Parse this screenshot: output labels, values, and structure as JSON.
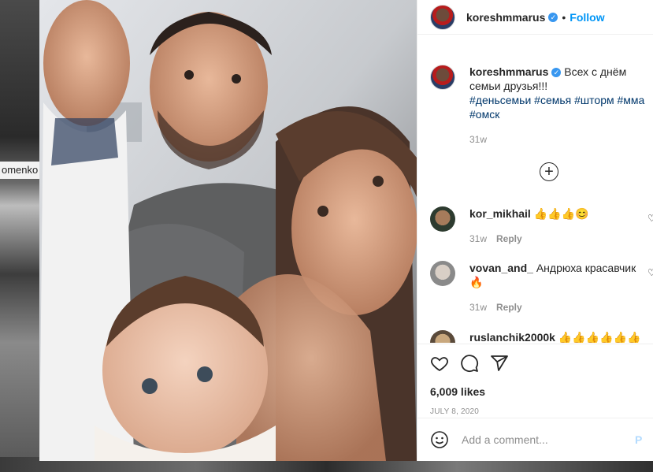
{
  "background": {
    "left_partial_text": "omenko"
  },
  "post": {
    "username": "koreshmmarus",
    "verified_mark": "✓",
    "dot": "•",
    "follow_label": "Follow",
    "caption": {
      "username": "koreshmmarus",
      "text": "Всех с днём семьи друзья!!!",
      "hashtags": "#деньсемьи #семья #шторм #мма #омск",
      "time": "31w"
    },
    "load_more_icon": "plus-circle-icon",
    "comments": [
      {
        "username": "kor_mikhail",
        "text": "👍👍👍😊",
        "time": "31w",
        "reply": "Reply"
      },
      {
        "username": "vovan_and_",
        "text": "Андрюха красавчик 🔥",
        "time": "31w",
        "reply": "Reply"
      },
      {
        "username": "ruslanchik2000k",
        "text": "👍👍👍👍👍👍",
        "time": "",
        "reply": ""
      }
    ],
    "likes": "6,009 likes",
    "date": "JULY 8, 2020",
    "add_comment_placeholder": "Add a comment...",
    "post_button": "P"
  },
  "colors": {
    "link_blue": "#0095f6",
    "hashtag_blue": "#00376b",
    "muted_gray": "#8e8e8e",
    "verified_blue": "#3897f0"
  }
}
